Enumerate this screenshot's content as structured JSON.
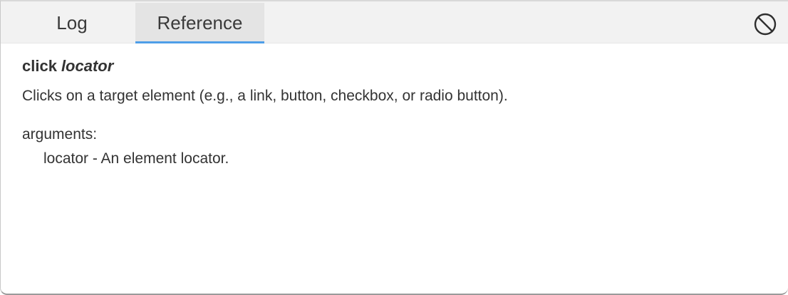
{
  "tabs": {
    "log_label": "Log",
    "reference_label": "Reference",
    "active": "reference"
  },
  "toolbar": {
    "clear_icon": "prohibited-circle-icon"
  },
  "reference": {
    "command": "click",
    "argument_name": "locator",
    "description": "Clicks on a target element (e.g., a link, button, checkbox, or radio button).",
    "arguments_heading": "arguments:",
    "arguments": [
      {
        "line": "locator - An element locator."
      }
    ]
  },
  "colors": {
    "tab_bar_bg": "#f2f2f2",
    "active_tab_bg": "#e4e4e4",
    "active_tab_indicator": "#4e9ee8",
    "text": "#333333"
  }
}
